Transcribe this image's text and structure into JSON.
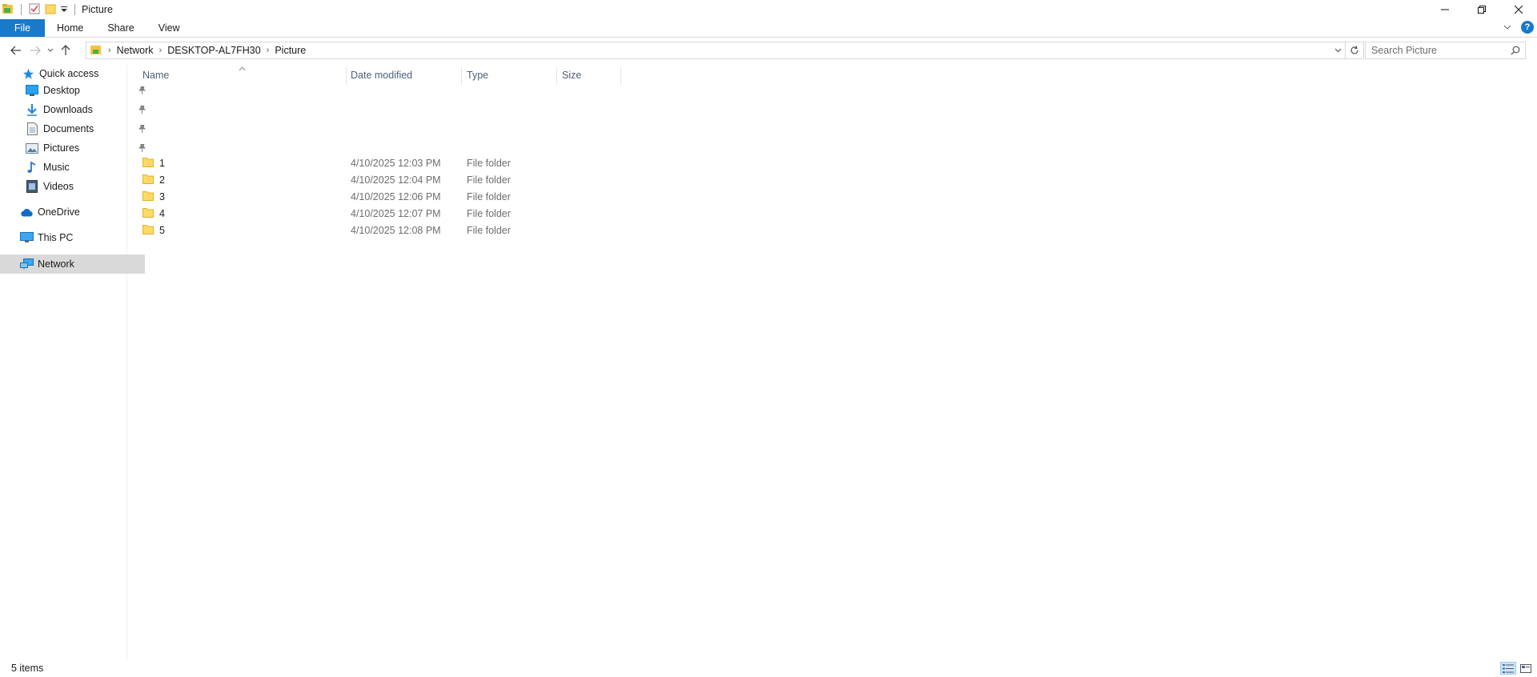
{
  "window": {
    "title": "Picture"
  },
  "ribbon": {
    "tabs": [
      "File",
      "Home",
      "Share",
      "View"
    ]
  },
  "address": {
    "crumbs": [
      "Network",
      "DESKTOP-AL7FH30",
      "Picture"
    ]
  },
  "search": {
    "placeholder": "Search Picture"
  },
  "sidebar": {
    "items": [
      {
        "label": "Quick access",
        "icon": "star-icon"
      },
      {
        "label": "Desktop",
        "icon": "desktop-icon",
        "pinned": true
      },
      {
        "label": "Downloads",
        "icon": "download-icon",
        "pinned": true
      },
      {
        "label": "Documents",
        "icon": "document-icon",
        "pinned": true
      },
      {
        "label": "Pictures",
        "icon": "pictures-icon",
        "pinned": true
      },
      {
        "label": "Music",
        "icon": "music-icon"
      },
      {
        "label": "Videos",
        "icon": "video-icon"
      },
      {
        "label": "OneDrive",
        "icon": "cloud-icon"
      },
      {
        "label": "This PC",
        "icon": "computer-icon"
      },
      {
        "label": "Network",
        "icon": "network-icon",
        "selected": true
      }
    ]
  },
  "columns": {
    "name": "Name",
    "date": "Date modified",
    "type": "Type",
    "size": "Size"
  },
  "files": [
    {
      "name": "1",
      "date": "4/10/2025 12:03 PM",
      "type": "File folder"
    },
    {
      "name": "2",
      "date": "4/10/2025 12:04 PM",
      "type": "File folder"
    },
    {
      "name": "3",
      "date": "4/10/2025 12:06 PM",
      "type": "File folder"
    },
    {
      "name": "4",
      "date": "4/10/2025 12:07 PM",
      "type": "File folder"
    },
    {
      "name": "5",
      "date": "4/10/2025 12:08 PM",
      "type": "File folder"
    }
  ],
  "status": {
    "item_count": "5 items"
  },
  "colors": {
    "accent": "#1979ca",
    "folder": "#ffd966",
    "selected": "#d9d9d9"
  }
}
